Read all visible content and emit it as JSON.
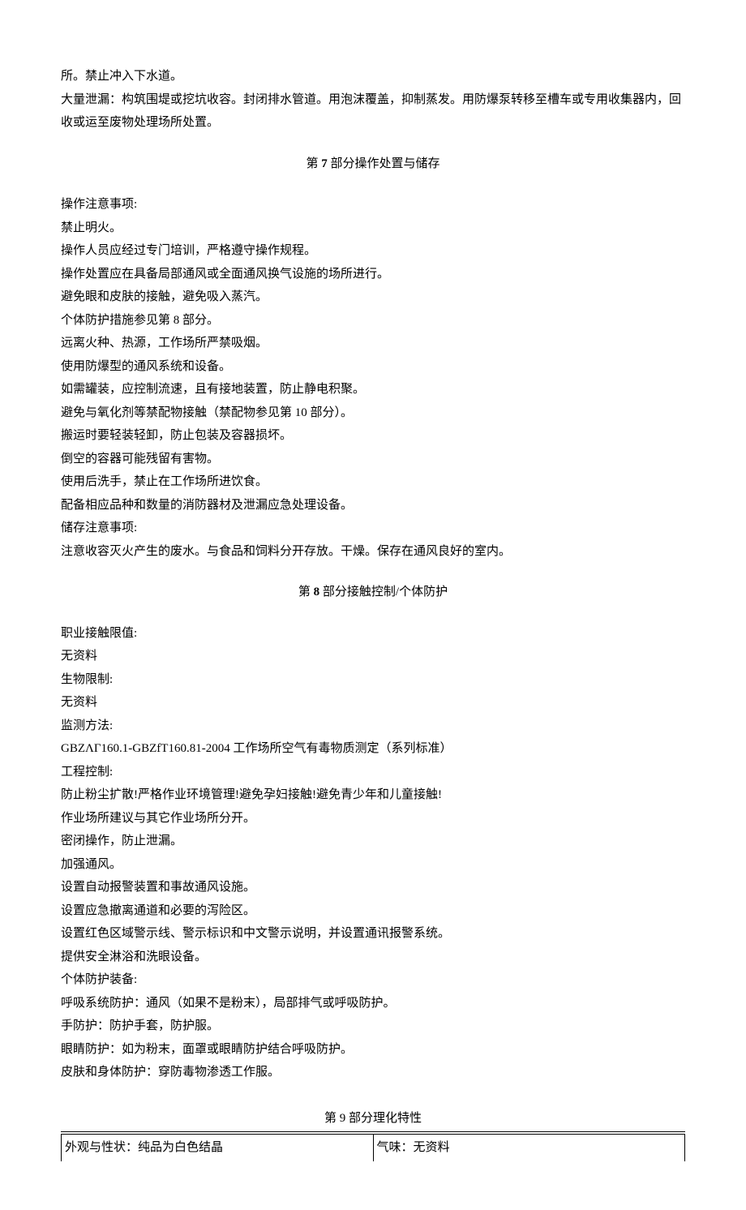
{
  "top_paragraphs": [
    "所。禁止冲入下水道。",
    "大量泄漏：构筑围堤或挖坑收容。封闭排水管道。用泡沫覆盖，抑制蒸发。用防爆泵转移至槽车或专用收集器内，回收或运至废物处理场所处置。"
  ],
  "section7": {
    "prefix": "第 ",
    "num": "7",
    "suffix": " 部分操作处置与储存",
    "lines": [
      "操作注意事项:",
      "禁止明火。",
      "操作人员应经过专门培训，严格遵守操作规程。",
      "操作处置应在具备局部通风或全面通风换气设施的场所进行。",
      "避免眼和皮肤的接触，避免吸入蒸汽。",
      "个体防护措施参见第 8 部分。",
      "远离火种、热源，工作场所严禁吸烟。",
      "使用防爆型的通风系统和设备。",
      "如需罐装，应控制流速，且有接地装置，防止静电积聚。",
      "避免与氧化剂等禁配物接触（禁配物参见第 10 部分）。",
      "搬运时要轻装轻卸，防止包装及容器损坏。",
      "倒空的容器可能残留有害物。",
      "使用后洗手，禁止在工作场所进饮食。",
      "配备相应品种和数量的消防器材及泄漏应急处理设备。",
      "储存注意事项:",
      "注意收容灭火产生的废水。与食品和饲料分开存放。干燥。保存在通风良好的室内。"
    ]
  },
  "section8": {
    "prefix": "第 ",
    "num": "8",
    "suffix": " 部分接触控制/个体防护",
    "lines": [
      "职业接触限值:",
      "无资料",
      "生物限制:",
      "无资料",
      "监测方法:",
      "GBZΛΓ160.1-GBZfT160.81-2004 工作场所空气有毒物质测定（系列标准）",
      "工程控制:",
      "防止粉尘扩散!严格作业环境管理!避免孕妇接触!避免青少年和儿童接触!",
      "作业场所建议与其它作业场所分开。",
      "密闭操作，防止泄漏。",
      "加强通风。",
      "设置自动报警装置和事故通风设施。",
      "设置应急撤离通道和必要的泻险区。",
      "设置红色区域警示线、警示标识和中文警示说明，并设置通讯报警系统。",
      "提供安全淋浴和洗眼设备。",
      "个体防护装备:",
      "呼吸系统防护：通风（如果不是粉末），局部排气或呼吸防护。",
      "手防护：防护手套，防护服。",
      "眼睛防护：如为粉末，面罩或眼睛防护结合呼吸防护。",
      "皮肤和身体防护：穿防毒物渗透工作服。"
    ]
  },
  "section9": {
    "heading": "第 9 部分理化特性",
    "row1": {
      "left": "外观与性状：纯品为白色结晶",
      "right": "气味：无资料"
    }
  }
}
